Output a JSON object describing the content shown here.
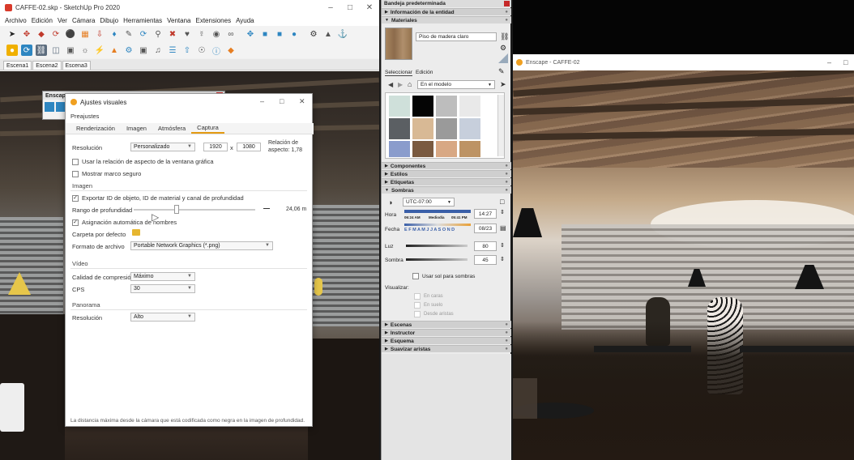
{
  "sketchup": {
    "title": "CAFFE-02.skp - SketchUp Pro 2020",
    "menu": [
      "Archivo",
      "Edición",
      "Ver",
      "Cámara",
      "Dibujo",
      "Herramientas",
      "Ventana",
      "Extensiones",
      "Ayuda"
    ],
    "scenes": [
      "Escena1",
      "Escena2",
      "Escena3"
    ]
  },
  "enscape_mini": {
    "title": "Enscape C"
  },
  "dialog": {
    "title": "Ajustes visuales",
    "presets_label": "Preajustes",
    "tabs": [
      "Renderización",
      "Imagen",
      "Atmósfera",
      "Captura"
    ],
    "active_tab": "Captura",
    "resolution_label": "Resolución",
    "resolution_value": "Personalizado",
    "width": "1920",
    "times": "x",
    "height": "1080",
    "aspect": "Relación de aspecto: 1,78",
    "use_window_aspect": "Usar la relación de aspecto de la ventana gráfica",
    "show_safe_frame": "Mostrar marco seguro",
    "image_section": "Imagen",
    "export_ids": "Exportar ID de objeto, ID de material y canal de profundidad",
    "depth_range_label": "Rango de profundidad",
    "depth_range_value": "24,06 m",
    "auto_names": "Asignación automática de nombres",
    "default_folder": "Carpeta por defecto",
    "file_format_label": "Formato de archivo",
    "file_format_value": "Portable Network Graphics (*.png)",
    "video_section": "Vídeo",
    "compression_label": "Calidad de compresión",
    "compression_value": "Máximo",
    "fps_label": "CPS",
    "fps_value": "30",
    "panorama_section": "Panorama",
    "pano_resolution_label": "Resolución",
    "pano_resolution_value": "Alto",
    "footer": "La distancia máxima desde la cámara que está codificada como negra en la imagen de profundidad."
  },
  "tray": {
    "title": "Bandeja predeterminada",
    "entity_info": "Información de la entidad",
    "materials": "Materiales",
    "material_name": "Piso de madera claro",
    "tab_select": "Seleccionar",
    "tab_edit": "Edición",
    "in_model": "En el modelo",
    "components": "Componentes",
    "styles": "Estilos",
    "labels": "Etiquetas",
    "shadows": "Sombras",
    "utc": "UTC-07:00",
    "hour_label": "Hora",
    "time_start": "06:24 AM",
    "time_mid": "Mediodía",
    "time_end": "05:41 PM",
    "time_value": "14:27",
    "date_label": "Fecha",
    "months": "E F M A M J J A S O N D",
    "date_value": "08/23",
    "light_label": "Luz",
    "light_value": "80",
    "shadow_label": "Sombra",
    "shadow_value": "45",
    "use_sun": "Usar sol para sombras",
    "display_label": "Visualizar:",
    "on_faces": "En caras",
    "on_ground": "En suelo",
    "from_edges": "Desde aristas",
    "scenes": "Escenas",
    "instructor": "Instructor",
    "outliner": "Esquema",
    "soften_edges": "Suavizar aristas"
  },
  "render": {
    "title": "Enscape - CAFFE-02"
  },
  "colors": {
    "accent": "#e39a12",
    "close_red": "#c62828"
  }
}
